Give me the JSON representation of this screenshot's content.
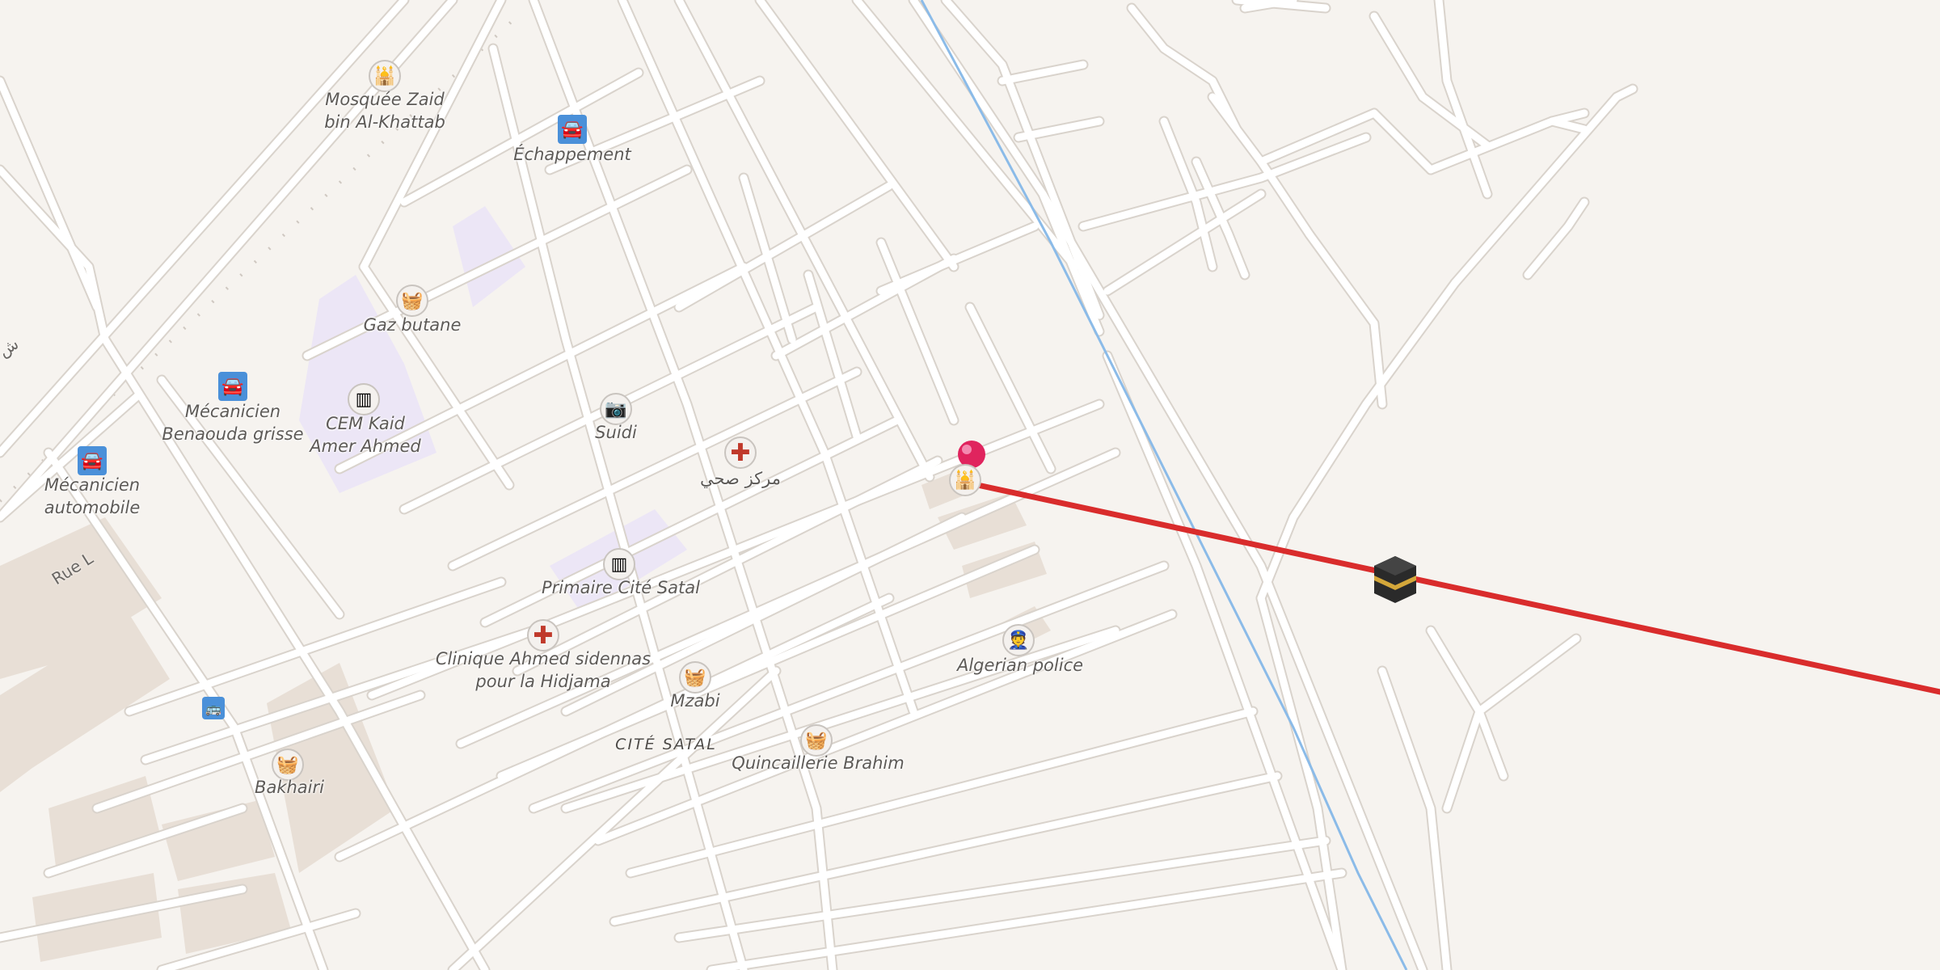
{
  "map": {
    "title": "",
    "colors": {
      "background": "#f6f3ef",
      "road": "#ffffff",
      "school_area": "#ece6f6",
      "building": "#e8dfd6",
      "railway": "#cfc8c1",
      "waterway": "#8bbbe8",
      "qibla_line": "#d92c2c",
      "pin": "#e0245e"
    },
    "labels": {
      "mosque_zaid": {
        "line1": "Mosquée Zaid",
        "line2": "bin Al-Khattab",
        "icon": "mosque-icon"
      },
      "echappement": {
        "line1": "Échappement",
        "icon": "car-repair-icon"
      },
      "gaz_butane": {
        "line1": "Gaz butane",
        "icon": "shop-basket-icon"
      },
      "mecanicien_benaouda": {
        "line1": "Mécanicien",
        "line2": "Benaouda grisse",
        "icon": "car-repair-icon"
      },
      "cem_kaid": {
        "line1": "CEM Kaid",
        "line2": "Amer Ahmed",
        "icon": "school-icon"
      },
      "mecanicien_auto": {
        "line1": "Mécanicien",
        "line2": "automobile",
        "icon": "car-repair-icon"
      },
      "suidi": {
        "line1": "Suidi",
        "icon": "camera-icon"
      },
      "markaz_sihhi": {
        "line1": "مركز صحي",
        "icon": "health-cross-icon"
      },
      "primaire": {
        "line1": "Primaire Cité Satal",
        "icon": "school-icon"
      },
      "clinique": {
        "line1": "Clinique Ahmed sidennas",
        "line2": "pour la Hidjama",
        "icon": "health-cross-icon"
      },
      "mzabi": {
        "line1": "Mzabi",
        "icon": "shop-basket-icon"
      },
      "algerian_police": {
        "line1": "Algerian police",
        "icon": "police-icon"
      },
      "quincaillerie": {
        "line1": "Quincaillerie Brahim",
        "icon": "shop-basket-icon"
      },
      "bakhairi": {
        "line1": "Bakhairi",
        "icon": "shop-basket-icon"
      },
      "bus_stop": {
        "icon": "bus-stop-icon"
      },
      "current_mosque": {
        "icon": "mosque-icon"
      }
    },
    "district": "CITÉ SATAL",
    "street_rue_l": "Rue L",
    "street_arabic_fragment": "ش",
    "markers": {
      "location_pin": "location-pin-icon",
      "kaaba": "kaaba-icon"
    }
  }
}
